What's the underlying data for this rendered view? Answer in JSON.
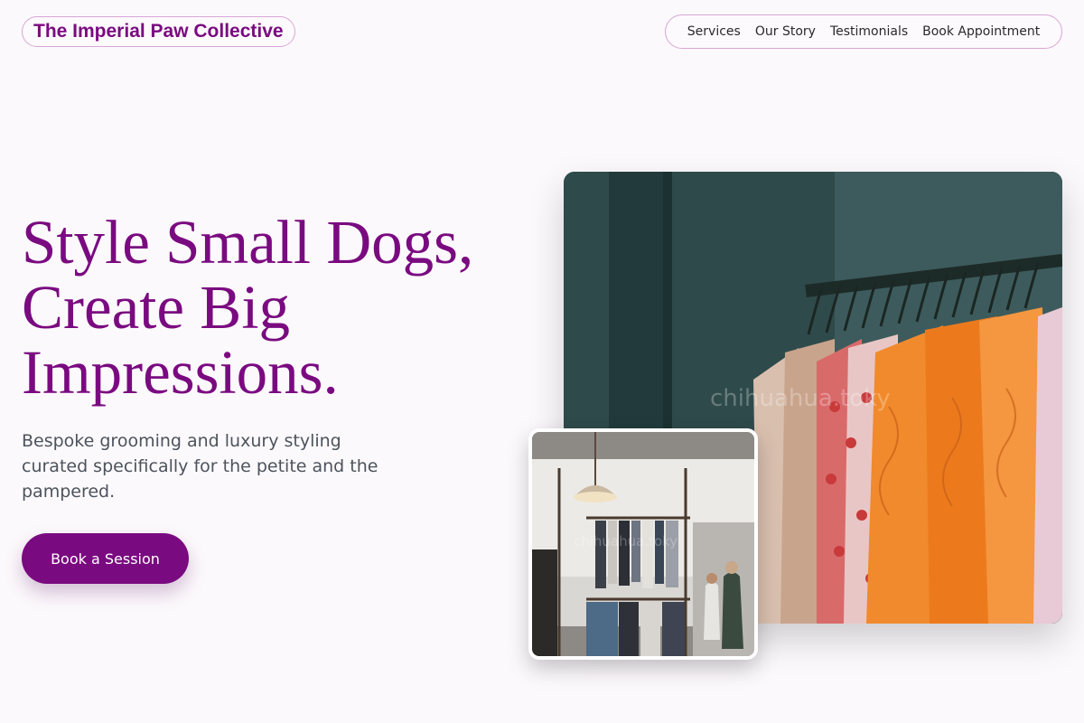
{
  "header": {
    "brand": "The Imperial Paw Collective",
    "nav": [
      "Services",
      "Our Story",
      "Testimonials",
      "Book Appointment"
    ]
  },
  "hero": {
    "headline_lines": [
      "Style Small Dogs,",
      "Create Big",
      "Impressions."
    ],
    "subtext": "Bespoke grooming and luxury styling curated specifically for the petite and the pampered.",
    "cta_label": "Book a Session"
  },
  "images": {
    "main_watermark": "chihuahua.toky",
    "inset_watermark": "chihuahua.toky",
    "main_icon": "clothing-rack-photo",
    "inset_icon": "boutique-interior-photo"
  },
  "colors": {
    "accent": "#7a0a80",
    "background": "#fcf9fc",
    "border": "#d8a6d6",
    "body_text": "#4c535c"
  }
}
